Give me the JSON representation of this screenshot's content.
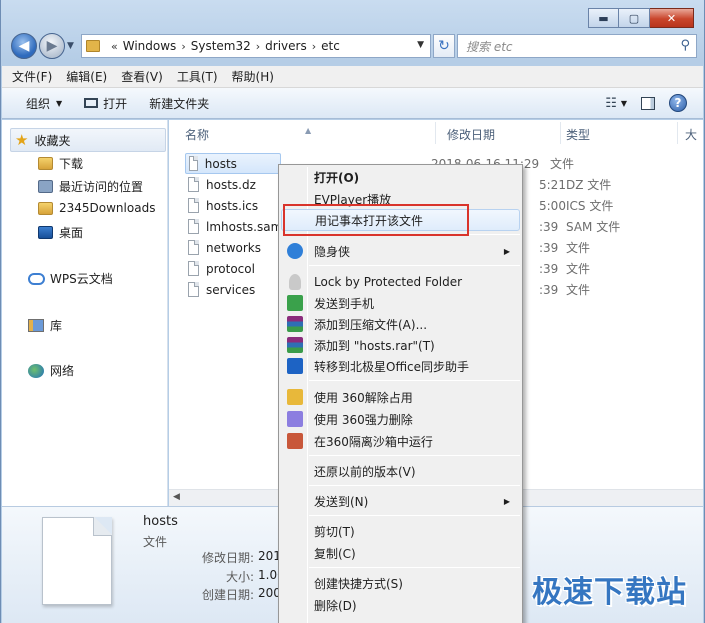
{
  "window": {
    "controls": {
      "minimize": "▬",
      "maximize": "▢",
      "close": "✕"
    }
  },
  "nav": {
    "back_icon": "◀",
    "forward_icon": "▶",
    "breadcrumb": [
      "Windows",
      "System32",
      "drivers",
      "etc"
    ],
    "crumb_separator": "›",
    "leading_chevron": "«",
    "refresh_icon": "↻",
    "search_placeholder": "搜索 etc",
    "search_icon": "⚲"
  },
  "menubar": [
    "文件(F)",
    "编辑(E)",
    "查看(V)",
    "工具(T)",
    "帮助(H)"
  ],
  "command_bar": {
    "organize": "组织",
    "open": "打开",
    "new_folder": "新建文件夹",
    "view_icon": "☷",
    "help_icon": "?"
  },
  "nav_pane": {
    "favorites": "收藏夹",
    "items": [
      "下载",
      "最近访问的位置",
      "2345Downloads",
      "桌面"
    ],
    "wps": "WPS云文档",
    "library": "库",
    "network": "网络"
  },
  "file_list": {
    "columns": {
      "name": "名称",
      "date": "修改日期",
      "type": "类型",
      "size": "大"
    },
    "rows": [
      {
        "name": "hosts",
        "date": "2018-06-16 11:29",
        "type": "文件",
        "selected": true
      },
      {
        "name": "hosts.dz",
        "date": "5:21",
        "type": "DZ 文件"
      },
      {
        "name": "hosts.ics",
        "date": "5:00",
        "type": "ICS 文件"
      },
      {
        "name": "lmhosts.sam",
        "date": ":39",
        "type": "SAM 文件"
      },
      {
        "name": "networks",
        "date": ":39",
        "type": "文件"
      },
      {
        "name": "protocol",
        "date": ":39",
        "type": "文件"
      },
      {
        "name": "services",
        "date": ":39",
        "type": "文件"
      }
    ]
  },
  "details": {
    "name": "hosts",
    "type": "文件",
    "modified_label": "修改日期:",
    "modified_value": "201",
    "size_label": "大小:",
    "size_value": "1.00",
    "created_label": "创建日期:",
    "created_value": "200"
  },
  "context_menu": {
    "items": [
      {
        "label": "打开(O)",
        "bold": true
      },
      {
        "label": "EVPlayer播放"
      },
      {
        "label": "用记事本打开该文件",
        "highlighted": true
      },
      {
        "label": "隐身侠",
        "submenu": true,
        "icon": "yinshenxia-icon"
      },
      {
        "label": "Lock by Protected Folder",
        "icon": "lock-icon"
      },
      {
        "label": "发送到手机",
        "icon": "phone-send-icon"
      },
      {
        "label": "添加到压缩文件(A)...",
        "icon": "winrar-icon"
      },
      {
        "label": "添加到 \"hosts.rar\"(T)",
        "icon": "winrar-icon"
      },
      {
        "label": "转移到北极星Office同步助手",
        "icon": "office-sync-icon"
      },
      {
        "label": "使用 360解除占用",
        "icon": "360-unlock-icon"
      },
      {
        "label": "使用 360强力删除",
        "icon": "360-delete-icon"
      },
      {
        "label": "在360隔离沙箱中运行",
        "icon": "360-sandbox-icon"
      },
      {
        "label": "还原以前的版本(V)"
      },
      {
        "label": "发送到(N)",
        "submenu": true
      },
      {
        "label": "剪切(T)"
      },
      {
        "label": "复制(C)"
      },
      {
        "label": "创建快捷方式(S)"
      },
      {
        "label": "删除(D)"
      }
    ],
    "submenu_arrow": "▶"
  },
  "watermark": "极速下载站",
  "colors": {
    "highlight_box": "#d9342b",
    "accent": "#3576c1"
  }
}
